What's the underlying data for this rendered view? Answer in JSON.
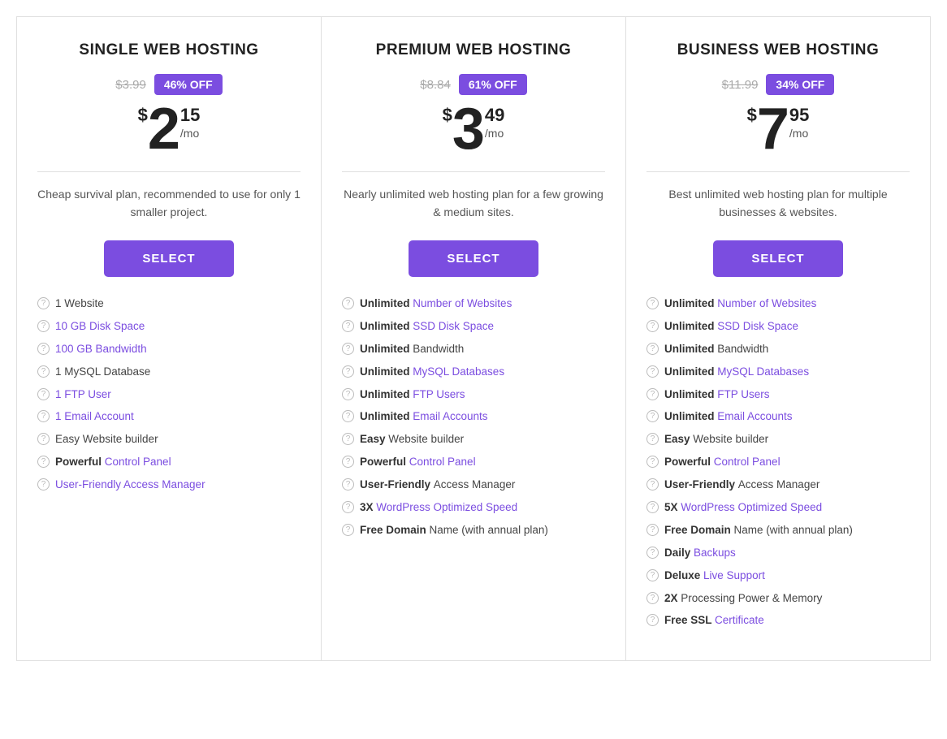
{
  "plans": [
    {
      "id": "single",
      "title": "SINGLE WEB HOSTING",
      "original_price": "$3.99",
      "discount": "46% OFF",
      "price_dollar": "$",
      "price_main": "2",
      "price_cents": "15",
      "price_mo": "/mo",
      "description": "Cheap survival plan, recommended to use for only 1 smaller project.",
      "select_label": "SELECT",
      "features": [
        {
          "bold": "",
          "link": "",
          "plain": "1 Website"
        },
        {
          "bold": "",
          "link": "10 GB Disk Space",
          "plain": ""
        },
        {
          "bold": "",
          "link": "100 GB Bandwidth",
          "plain": ""
        },
        {
          "bold": "",
          "link": "",
          "plain": "1 MySQL Database"
        },
        {
          "bold": "",
          "link": "1 FTP User",
          "plain": ""
        },
        {
          "bold": "",
          "link": "1 Email Account",
          "plain": ""
        },
        {
          "bold": "",
          "link": "",
          "plain": "Easy Website builder"
        },
        {
          "bold": "Powerful",
          "link": "Control Panel",
          "plain": ""
        },
        {
          "bold": "",
          "link": "User-Friendly Access Manager",
          "plain": ""
        }
      ]
    },
    {
      "id": "premium",
      "title": "PREMIUM WEB HOSTING",
      "original_price": "$8.84",
      "discount": "61% OFF",
      "price_dollar": "$",
      "price_main": "3",
      "price_cents": "49",
      "price_mo": "/mo",
      "description": "Nearly unlimited web hosting plan for a few growing & medium sites.",
      "select_label": "SELECT",
      "features": [
        {
          "bold": "Unlimited",
          "link": "Number of Websites",
          "plain": ""
        },
        {
          "bold": "Unlimited",
          "link": "SSD Disk Space",
          "plain": ""
        },
        {
          "bold": "Unlimited",
          "link": "",
          "plain": "Bandwidth"
        },
        {
          "bold": "Unlimited",
          "link": "MySQL Databases",
          "plain": ""
        },
        {
          "bold": "Unlimited",
          "link": "FTP Users",
          "plain": ""
        },
        {
          "bold": "Unlimited",
          "link": "Email Accounts",
          "plain": ""
        },
        {
          "bold": "Easy",
          "link": "",
          "plain": "Website builder"
        },
        {
          "bold": "Powerful",
          "link": "Control Panel",
          "plain": ""
        },
        {
          "bold": "User-Friendly",
          "link": "",
          "plain": "Access Manager"
        },
        {
          "bold": "3X",
          "link": "WordPress Optimized Speed",
          "plain": ""
        },
        {
          "bold": "Free Domain",
          "link": "",
          "plain": "Name (with annual plan)"
        }
      ]
    },
    {
      "id": "business",
      "title": "BUSINESS WEB HOSTING",
      "original_price": "$11.99",
      "discount": "34% OFF",
      "price_dollar": "$",
      "price_main": "7",
      "price_cents": "95",
      "price_mo": "/mo",
      "description": "Best unlimited web hosting plan for multiple businesses & websites.",
      "select_label": "SELECT",
      "features": [
        {
          "bold": "Unlimited",
          "link": "Number of Websites",
          "plain": ""
        },
        {
          "bold": "Unlimited",
          "link": "SSD Disk Space",
          "plain": ""
        },
        {
          "bold": "Unlimited",
          "link": "",
          "plain": "Bandwidth"
        },
        {
          "bold": "Unlimited",
          "link": "MySQL Databases",
          "plain": ""
        },
        {
          "bold": "Unlimited",
          "link": "FTP Users",
          "plain": ""
        },
        {
          "bold": "Unlimited",
          "link": "Email Accounts",
          "plain": ""
        },
        {
          "bold": "Easy",
          "link": "",
          "plain": "Website builder"
        },
        {
          "bold": "Powerful",
          "link": "Control Panel",
          "plain": ""
        },
        {
          "bold": "User-Friendly",
          "link": "",
          "plain": "Access Manager"
        },
        {
          "bold": "5X",
          "link": "WordPress Optimized Speed",
          "plain": ""
        },
        {
          "bold": "Free Domain",
          "link": "",
          "plain": "Name (with annual plan)"
        },
        {
          "bold": "Daily",
          "link": "Backups",
          "plain": ""
        },
        {
          "bold": "Deluxe",
          "link": "Live Support",
          "plain": ""
        },
        {
          "bold": "2X",
          "link": "",
          "plain": "Processing Power & Memory"
        },
        {
          "bold": "Free SSL",
          "link": "Certificate",
          "plain": ""
        }
      ]
    }
  ]
}
